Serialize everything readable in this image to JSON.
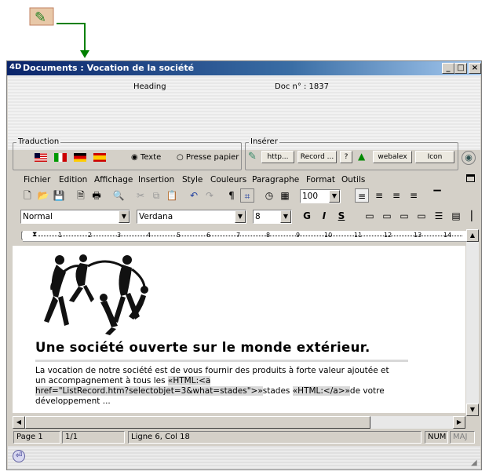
{
  "window": {
    "title": "Documents : Vocation de la société",
    "minimize": "_",
    "maximize": "□",
    "close": "×"
  },
  "header": {
    "heading": "Heading",
    "doc_no": "Doc n° : 1837"
  },
  "traduction": {
    "label": "Traduction",
    "radio_texte": "Texte",
    "radio_presse": "Presse papier"
  },
  "inserer": {
    "label": "Insérer",
    "http": "http...",
    "record": "Record ...",
    "help": "?",
    "webalex": "webalex",
    "icon": "Icon"
  },
  "menu": [
    "Fichier",
    "Edition",
    "Affichage",
    "Insertion",
    "Style",
    "Couleurs",
    "Paragraphe",
    "Format",
    "Outils"
  ],
  "toolbar": {
    "zoom": "100",
    "style": "Normal",
    "font": "Verdana",
    "size": "8",
    "bold": "G",
    "italic": "I",
    "underline": "S"
  },
  "ruler": [
    "1",
    "2",
    "3",
    "4",
    "5",
    "6",
    "7",
    "8",
    "9",
    "10",
    "11",
    "12",
    "13",
    "14"
  ],
  "document": {
    "heading": "Une société ouverte sur le monde extérieur.",
    "p1": "La vocation de notre société est de vous fournir des produits à forte valeur ajoutée et",
    "p2a": "un accompagnement à tous les ",
    "tag1": "«HTML:<a",
    "tag2": "href=\"ListRecord.htm?selectobjet=3&what=stades\">»",
    "p3": "stades ",
    "tag3": "«HTML:</a>»",
    "p4": "de votre",
    "p5": "développement ..."
  },
  "status": {
    "page": "Page 1",
    "pages": "1/1",
    "position": "Ligne 6, Col 18",
    "num": "NUM",
    "maj": "MAJ"
  }
}
